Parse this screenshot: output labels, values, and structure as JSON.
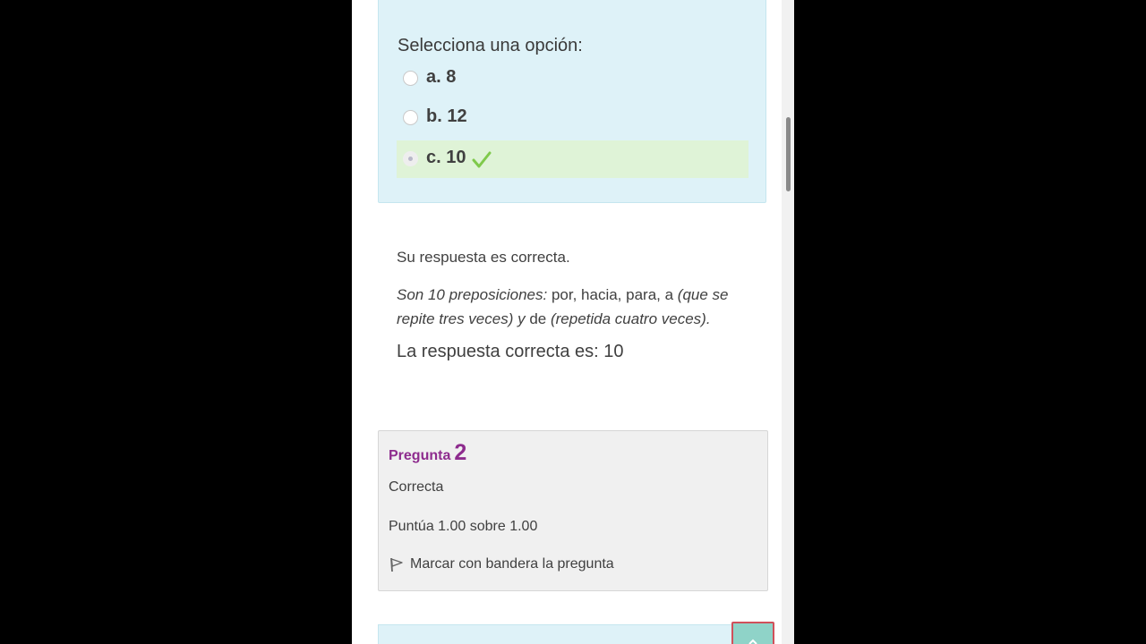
{
  "question1": {
    "prompt": "Selecciona una opción:",
    "options": [
      {
        "label": "a. 8",
        "selected": false,
        "correct": false
      },
      {
        "label": "b. 12",
        "selected": false,
        "correct": false
      },
      {
        "label": "c. 10",
        "selected": true,
        "correct": true
      }
    ]
  },
  "feedback": {
    "status": "Su respuesta es correcta.",
    "general_parts": [
      {
        "text": "Son 10 preposiciones:",
        "italic": true
      },
      {
        "text": " por, hacia, para, a ",
        "italic": false
      },
      {
        "text": "(que se repite tres veces) y",
        "italic": true
      },
      {
        "text": " de ",
        "italic": false
      },
      {
        "text": "(repetida cuatro veces).",
        "italic": true
      }
    ],
    "right_answer": "La respuesta correcta es: 10"
  },
  "question2": {
    "title_word": "Pregunta",
    "number": "2",
    "state": "Correcta",
    "grade": "Puntúa 1.00 sobre 1.00",
    "flag_label": "Marcar con bandera la pregunta"
  },
  "icons": {
    "check": "check-icon",
    "flag": "flag-icon",
    "back_to_top": "chevron-up-icon"
  },
  "colors": {
    "answer_bg": "#def2f8",
    "correct_bg": "#dff3d7",
    "check_green": "#7fc94b",
    "question_title": "#8e2c8e",
    "info_bg": "#f0f0f0",
    "back_to_top_bg": "#8fd3c8"
  }
}
